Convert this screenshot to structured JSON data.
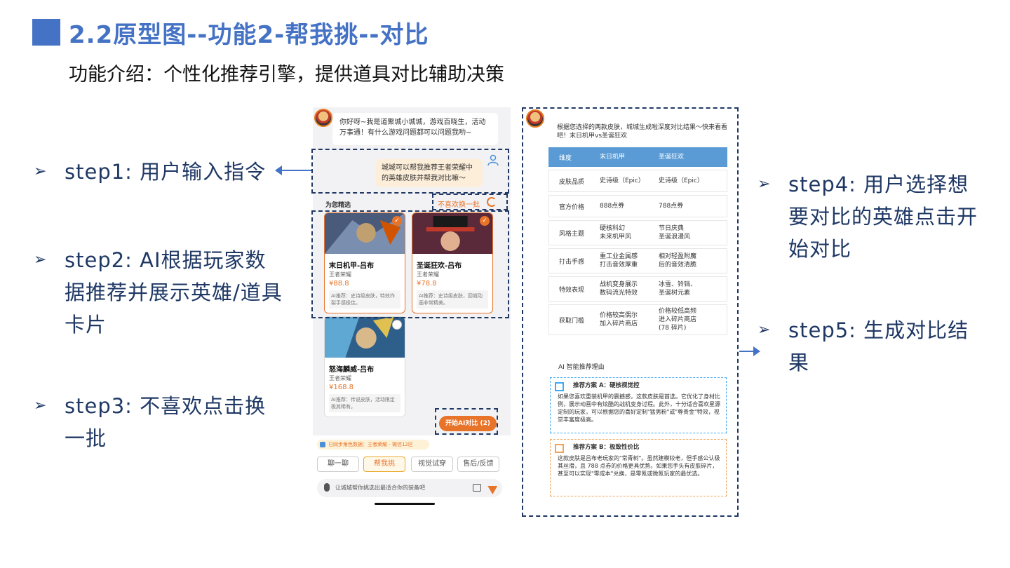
{
  "slide": {
    "title": "2.2原型图--功能2-帮我挑--对比",
    "subtitle": "功能介绍：个性化推荐引擎，提供道具对比辅助决策"
  },
  "steps": {
    "step1": "step1: 用户输入指令",
    "step2": "step2: AI根据玩家数据推荐并展示英雄/道具卡片",
    "step3": "step3: 不喜欢点击换一批",
    "step4": "step4: 用户选择想要对比的英雄点击开始对比",
    "step5": "step5: 生成对比结果"
  },
  "chat": {
    "bot_greeting": "你好呀~我是道聚城小城城，游戏百晓生，活动万事通！有什么游戏问题都可以问题我哟~",
    "user_message": "城城可以帮我推荐王者荣耀中的英雄皮肤并帮我对比嘛～",
    "section_label": "为您精选",
    "refresh_label": "不喜欢换一批",
    "compare_button": "开始AI对比 (2)"
  },
  "cards": [
    {
      "name": "末日机甲-吕布",
      "game": "王者荣耀",
      "price": "¥88.8",
      "note": "AI推荐：史诗级皮肤，特效炸裂手感极佳。",
      "selected": true
    },
    {
      "name": "圣诞狂欢-吕布",
      "game": "王者荣耀",
      "price": "¥78.8",
      "note": "AI推荐：史诗级皮肤，回城动画非常精美。",
      "selected": true
    },
    {
      "name": "怒海麟威-吕布",
      "game": "王者荣耀",
      "price": "¥168.8",
      "note": "AI推荐：传说皮肤，活动限定极其稀有。",
      "selected": false
    }
  ],
  "bottom": {
    "sync_text": "已同步角色数据：王者荣耀 - 微信12区",
    "tabs": [
      "聊一聊",
      "帮我挑",
      "视觉试穿",
      "售后/反馈"
    ],
    "active_tab": "帮我挑",
    "input_placeholder": "让城城帮你挑选出最适合你的装备吧"
  },
  "compare": {
    "intro": "根据您选择的两款皮肤，城城生成啦深度对比结果～快来看看吧！末日机甲vs圣诞狂欢",
    "header": [
      "维度",
      "末日机甲",
      "圣诞狂欢"
    ],
    "rows": [
      [
        "皮肤品质",
        "史诗级（Epic）",
        "史诗级（Epic）"
      ],
      [
        "官方价格",
        "888点券",
        "788点券"
      ],
      [
        "风格主题",
        "硬核科幻\n未来机甲风",
        "节日庆典\n圣诞浪漫风"
      ],
      [
        "打击手感",
        "重工业金属感\n打击音效厚重",
        "相对轻盈附魔\n后的音效清脆"
      ],
      [
        "特效表现",
        "战机变身展示\n数码流光特效",
        "冰雪、铃铛、\n圣诞树元素"
      ],
      [
        "获取门槛",
        "价格较高偶尔\n加入碎片商店",
        "价格较低高频\n进入碎片商店\n(78 碎片)"
      ]
    ],
    "ai_title": "AI 智能推荐理由",
    "plan_a_title": "推荐方案 A：硬核视觉控",
    "plan_a_text": "如果您喜欢重装机甲的震撼感，这款皮肤是首选。它优化了身材比例，展示动画中有炫酷的战机变身过程。此外，十分适合喜欢星源定制的玩家，可以根据您的喜好定制\"猛男粉\"或\"尊贵金\"特效，视觉丰富度极高。",
    "plan_b_title": "推荐方案 B：极致性价比",
    "plan_b_text": "这款皮肤是吕布老玩家的\"常青树\"。虽然建模较老，但手感公认极其丝滑，且 788 点券的价格更具优势。如果您手头有皮肤碎片，甚至可以实现\"零成本\"兑换，是零氪或微氪玩家的最优选。"
  },
  "colors": {
    "accent": "#4472c4",
    "step_text": "#1f3864",
    "orange": "#e8742a",
    "table_head": "#5b9bd5"
  }
}
